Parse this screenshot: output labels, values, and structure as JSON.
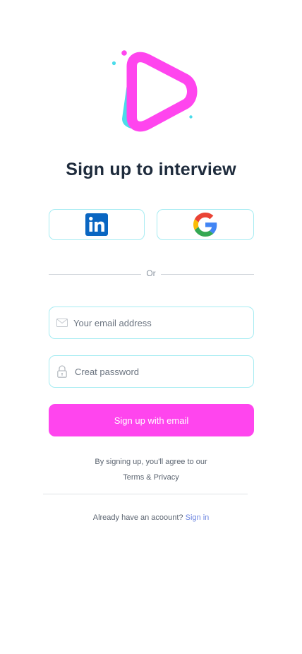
{
  "brand": {
    "logo_icon": "play-triangle-logo",
    "primary_color": "#ff45ee",
    "accent_color": "#4bdcea"
  },
  "page": {
    "title": "Sign up to interview"
  },
  "social": {
    "linkedin_icon": "linkedin-icon",
    "google_icon": "google-icon"
  },
  "divider": {
    "label": "Or"
  },
  "email": {
    "placeholder": "Your email address",
    "value": "",
    "icon": "mail-icon"
  },
  "password": {
    "placeholder": "Creat password",
    "value": "",
    "icon": "lock-icon"
  },
  "submit": {
    "label": "Sign up with email"
  },
  "terms": {
    "prefix": "By signing up, you'll agree to our",
    "link": "Terms & Privacy"
  },
  "signin": {
    "prompt": "Already have  an acoount?",
    "link": "Sign in"
  }
}
